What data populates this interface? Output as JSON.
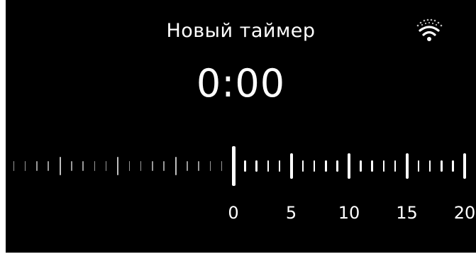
{
  "header": {
    "title": "Новый таймер",
    "wifi_icon": "wifi-icon"
  },
  "timer": {
    "value": "0:00"
  },
  "scale": {
    "labels": [
      "0",
      "5",
      "10",
      "15",
      "20"
    ],
    "selected": "0"
  },
  "colors": {
    "background": "#000000",
    "foreground": "#ffffff"
  }
}
